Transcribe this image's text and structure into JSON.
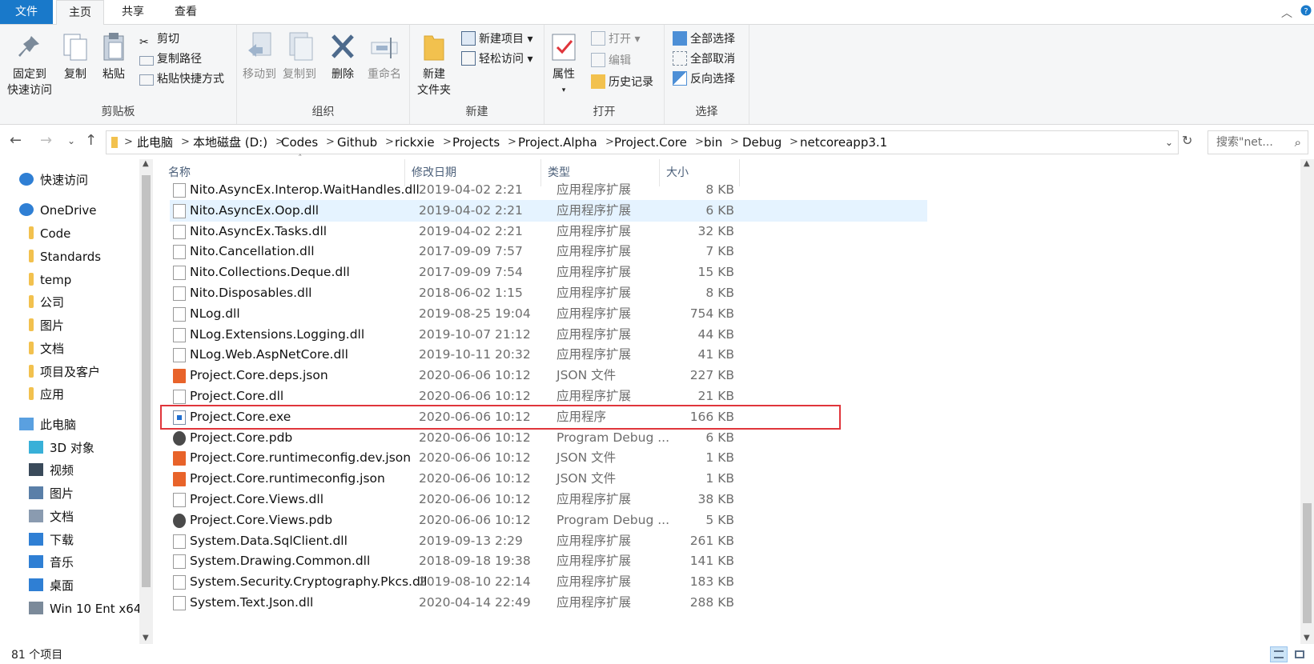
{
  "tabs": {
    "file": "文件",
    "home": "主页",
    "share": "共享",
    "view": "查看"
  },
  "ribbon": {
    "clipboard": {
      "label": "剪贴板",
      "pin_line1": "固定到",
      "pin_line2": "快速访问",
      "copy": "复制",
      "paste": "粘贴",
      "cut": "剪切",
      "copy_path": "复制路径",
      "paste_shortcut": "粘贴快捷方式"
    },
    "organize": {
      "label": "组织",
      "move_to": "移动到",
      "copy_to": "复制到",
      "delete": "删除",
      "rename": "重命名"
    },
    "new": {
      "label": "新建",
      "new_folder_line1": "新建",
      "new_folder_line2": "文件夹",
      "new_item": "新建项目",
      "easy_access": "轻松访问"
    },
    "open": {
      "label": "打开",
      "properties": "属性",
      "open": "打开",
      "edit": "编辑",
      "history": "历史记录"
    },
    "select": {
      "label": "选择",
      "select_all": "全部选择",
      "select_none": "全部取消",
      "invert": "反向选择"
    }
  },
  "address": {
    "crumbs": [
      "此电脑",
      "本地磁盘 (D:)",
      "Codes",
      "Github",
      "rickxie",
      "Projects",
      "Project.Alpha",
      "Project.Core",
      "bin",
      "Debug",
      "netcoreapp3.1"
    ],
    "search_placeholder": "搜索\"net..."
  },
  "navpane": {
    "items": [
      {
        "label": "快速访问",
        "icon": "star-icon"
      },
      {
        "label": "OneDrive",
        "icon": "cloud-icon"
      },
      {
        "label": "Code",
        "icon": "folder-icon"
      },
      {
        "label": "Standards",
        "icon": "folder-icon"
      },
      {
        "label": "temp",
        "icon": "folder-icon"
      },
      {
        "label": "公司",
        "icon": "folder-icon"
      },
      {
        "label": "图片",
        "icon": "folder-icon"
      },
      {
        "label": "文档",
        "icon": "folder-icon"
      },
      {
        "label": "项目及客户",
        "icon": "folder-icon"
      },
      {
        "label": "应用",
        "icon": "folder-icon"
      },
      {
        "label": "此电脑",
        "icon": "computer-icon"
      },
      {
        "label": "3D 对象",
        "icon": "cube-icon"
      },
      {
        "label": "视频",
        "icon": "film-icon"
      },
      {
        "label": "图片",
        "icon": "picture-icon"
      },
      {
        "label": "文档",
        "icon": "document-icon"
      },
      {
        "label": "下载",
        "icon": "download-icon"
      },
      {
        "label": "音乐",
        "icon": "music-icon"
      },
      {
        "label": "桌面",
        "icon": "desktop-icon"
      },
      {
        "label": "Win 10 Ent x64",
        "icon": "drive-icon"
      }
    ]
  },
  "columns": {
    "name": "名称",
    "date": "修改日期",
    "type": "类型",
    "size": "大小"
  },
  "files": [
    {
      "name": "Nito.AsyncEx.Interop.WaitHandles.dll",
      "date": "2019-04-02 2:21",
      "type": "应用程序扩展",
      "size": "8 KB",
      "icon": "dll"
    },
    {
      "name": "Nito.AsyncEx.Oop.dll",
      "date": "2019-04-02 2:21",
      "type": "应用程序扩展",
      "size": "6 KB",
      "icon": "dll"
    },
    {
      "name": "Nito.AsyncEx.Tasks.dll",
      "date": "2019-04-02 2:21",
      "type": "应用程序扩展",
      "size": "32 KB",
      "icon": "dll"
    },
    {
      "name": "Nito.Cancellation.dll",
      "date": "2017-09-09 7:57",
      "type": "应用程序扩展",
      "size": "7 KB",
      "icon": "dll"
    },
    {
      "name": "Nito.Collections.Deque.dll",
      "date": "2017-09-09 7:54",
      "type": "应用程序扩展",
      "size": "15 KB",
      "icon": "dll"
    },
    {
      "name": "Nito.Disposables.dll",
      "date": "2018-06-02 1:15",
      "type": "应用程序扩展",
      "size": "8 KB",
      "icon": "dll"
    },
    {
      "name": "NLog.dll",
      "date": "2019-08-25 19:04",
      "type": "应用程序扩展",
      "size": "754 KB",
      "icon": "dll"
    },
    {
      "name": "NLog.Extensions.Logging.dll",
      "date": "2019-10-07 21:12",
      "type": "应用程序扩展",
      "size": "44 KB",
      "icon": "dll"
    },
    {
      "name": "NLog.Web.AspNetCore.dll",
      "date": "2019-10-11 20:32",
      "type": "应用程序扩展",
      "size": "41 KB",
      "icon": "dll"
    },
    {
      "name": "Project.Core.deps.json",
      "date": "2020-06-06 10:12",
      "type": "JSON 文件",
      "size": "227 KB",
      "icon": "json"
    },
    {
      "name": "Project.Core.dll",
      "date": "2020-06-06 10:12",
      "type": "应用程序扩展",
      "size": "21 KB",
      "icon": "dll"
    },
    {
      "name": "Project.Core.exe",
      "date": "2020-06-06 10:12",
      "type": "应用程序",
      "size": "166 KB",
      "icon": "exe"
    },
    {
      "name": "Project.Core.pdb",
      "date": "2020-06-06 10:12",
      "type": "Program Debug ...",
      "size": "6 KB",
      "icon": "pdb"
    },
    {
      "name": "Project.Core.runtimeconfig.dev.json",
      "date": "2020-06-06 10:12",
      "type": "JSON 文件",
      "size": "1 KB",
      "icon": "json"
    },
    {
      "name": "Project.Core.runtimeconfig.json",
      "date": "2020-06-06 10:12",
      "type": "JSON 文件",
      "size": "1 KB",
      "icon": "json"
    },
    {
      "name": "Project.Core.Views.dll",
      "date": "2020-06-06 10:12",
      "type": "应用程序扩展",
      "size": "38 KB",
      "icon": "dll"
    },
    {
      "name": "Project.Core.Views.pdb",
      "date": "2020-06-06 10:12",
      "type": "Program Debug ...",
      "size": "5 KB",
      "icon": "pdb"
    },
    {
      "name": "System.Data.SqlClient.dll",
      "date": "2019-09-13 2:29",
      "type": "应用程序扩展",
      "size": "261 KB",
      "icon": "dll"
    },
    {
      "name": "System.Drawing.Common.dll",
      "date": "2018-09-18 19:38",
      "type": "应用程序扩展",
      "size": "141 KB",
      "icon": "dll"
    },
    {
      "name": "System.Security.Cryptography.Pkcs.dll",
      "date": "2019-08-10 22:14",
      "type": "应用程序扩展",
      "size": "183 KB",
      "icon": "dll"
    },
    {
      "name": "System.Text.Json.dll",
      "date": "2020-04-14 22:49",
      "type": "应用程序扩展",
      "size": "288 KB",
      "icon": "dll"
    }
  ],
  "status": {
    "count": "81 个项目"
  },
  "colors": {
    "accent": "#1979ca",
    "highlight_box": "#e0353b",
    "hover_row": "#e5f3ff"
  }
}
